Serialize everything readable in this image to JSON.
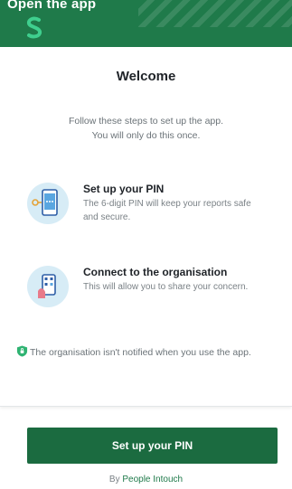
{
  "header": {
    "title": "Open the app",
    "logo_icon": "s-logo-icon"
  },
  "main": {
    "welcome": "Welcome",
    "intro_line1": "Follow these steps to set up the app.",
    "intro_line2": "You will only do this once.",
    "steps": [
      {
        "title": "Set up your PIN",
        "desc": "The 6-digit PIN will keep your reports safe and secure.",
        "icon": "phone-pin-icon"
      },
      {
        "title": "Connect to the organisation",
        "desc": "This will allow you to share your concern.",
        "icon": "qr-scan-icon"
      }
    ],
    "notice": "The organisation isn't notified when you use the app.",
    "notice_icon": "shield-icon"
  },
  "footer": {
    "cta_label": "Set up your PIN",
    "by_prefix": "By",
    "by_brand": "People Intouch"
  },
  "colors": {
    "brand": "#1f7a4a",
    "button": "#1b6b40",
    "bubble": "#d7ecf6"
  }
}
